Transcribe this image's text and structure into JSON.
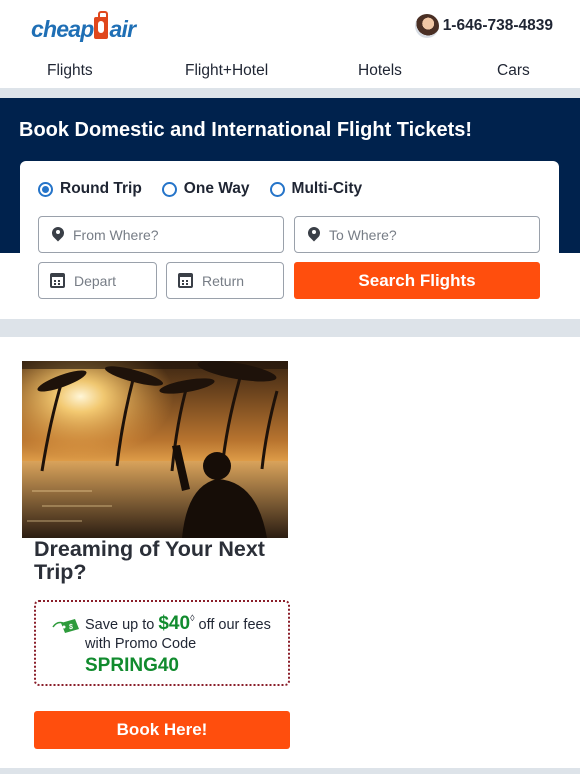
{
  "header": {
    "logo_text": "cheapOair",
    "logo_parts": {
      "a": "cheap",
      "b": "air"
    },
    "phone": "1-646-738-4839"
  },
  "nav": {
    "items": [
      "Flights",
      "Flight+Hotel",
      "Hotels",
      "Cars"
    ]
  },
  "hero": {
    "title": "Book Domestic and International Flight Tickets!"
  },
  "search": {
    "trip_types": [
      {
        "label": "Round Trip",
        "selected": true
      },
      {
        "label": "One Way",
        "selected": false
      },
      {
        "label": "Multi-City",
        "selected": false
      }
    ],
    "from_placeholder": "From Where?",
    "to_placeholder": "To Where?",
    "depart_placeholder": "Depart",
    "return_placeholder": "Return",
    "button_label": "Search Flights"
  },
  "promo": {
    "title": "Dreaming of Your Next Trip?",
    "save_prefix": "Save up to ",
    "amount": "$40",
    "amount_mark": "◊",
    "save_suffix": " off our fees",
    "code_intro": "with Promo Code",
    "code": "SPRING40",
    "tag_value": "$",
    "button_label": "Book Here!"
  },
  "colors": {
    "brand_blue": "#1f6fb5",
    "hero_navy": "#00224d",
    "accent_orange": "#ff4e0d",
    "promo_green": "#118b2e"
  }
}
